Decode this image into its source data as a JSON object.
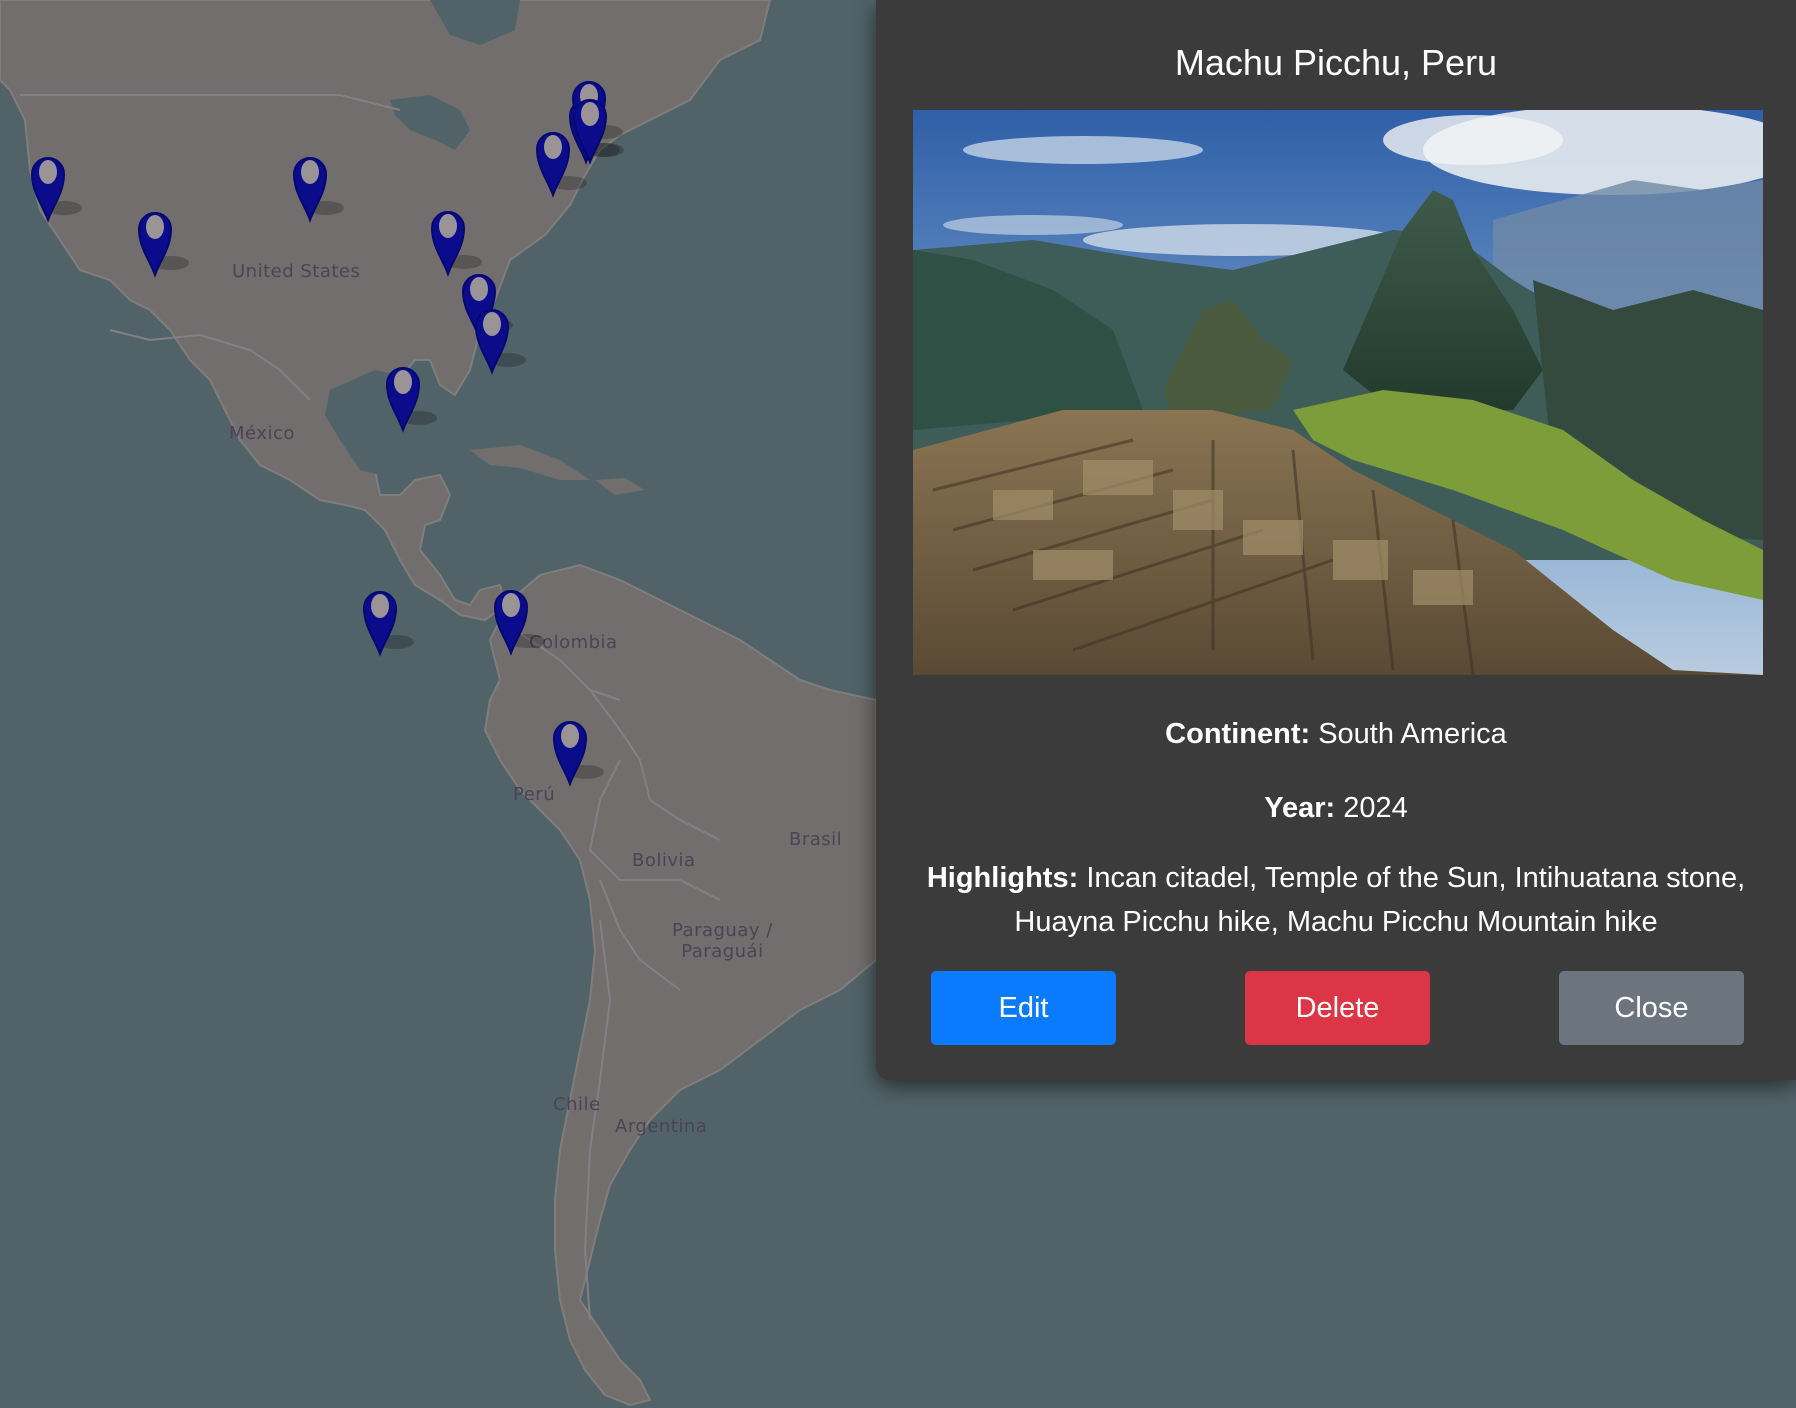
{
  "map": {
    "labels": {
      "united_states": "United States",
      "mexico": "México",
      "colombia": "Colombia",
      "peru": "Perú",
      "brasil": "Brasil",
      "bolivia": "Bolivia",
      "paraguay": "Paraguay /\nParaguái",
      "chile": "Chile",
      "argentina": "Argentina"
    },
    "marker_icon": "map-pin-icon",
    "marker_color": "#0b0c8c",
    "land_color": "#7d7775",
    "water_color": "#566970"
  },
  "modal": {
    "title": "Machu Picchu, Peru",
    "photo_description_icon": "landscape-photo",
    "continent_label": "Continent:",
    "continent_value": "South America",
    "year_label": "Year:",
    "year_value": "2024",
    "highlights_label": "Highlights:",
    "highlights_value": "Incan citadel, Temple of the Sun, Intihuatana stone, Huayna Picchu hike, Machu Picchu Mountain hike",
    "buttons": {
      "edit": "Edit",
      "delete": "Delete",
      "close": "Close"
    },
    "colors": {
      "background": "#3b3b3b",
      "edit": "#0a7bff",
      "delete": "#dc3545",
      "close": "#6c757d"
    }
  }
}
